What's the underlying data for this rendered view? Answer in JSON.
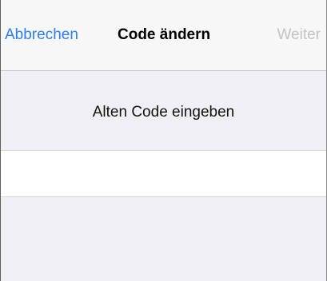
{
  "navbar": {
    "cancel_label": "Abbrechen",
    "title": "Code ändern",
    "next_label": "Weiter"
  },
  "main": {
    "prompt": "Alten Code eingeben",
    "code_value": ""
  },
  "colors": {
    "accent": "#2f7df6",
    "disabled": "#c4c4c6",
    "background": "#f0eff4"
  }
}
